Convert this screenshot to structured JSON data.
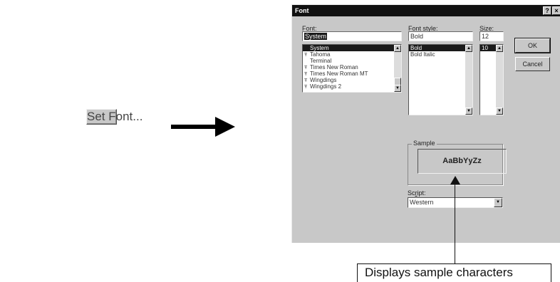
{
  "set_font_button": {
    "label": "Set Font..."
  },
  "dialog": {
    "title": "Font",
    "help_glyph": "?",
    "close_glyph": "×",
    "font": {
      "label_initial": "F",
      "label_rest": "ont:",
      "value": "System",
      "items": [
        {
          "name": "System",
          "truetype": false,
          "selected": true
        },
        {
          "name": "Tahoma",
          "truetype": true,
          "selected": false
        },
        {
          "name": "Terminal",
          "truetype": false,
          "selected": false
        },
        {
          "name": "Times New Roman",
          "truetype": true,
          "selected": false
        },
        {
          "name": "Times New Roman MT",
          "truetype": true,
          "selected": false
        },
        {
          "name": "Wingdings",
          "truetype": true,
          "selected": false
        },
        {
          "name": "Wingdings 2",
          "truetype": true,
          "selected": false
        }
      ]
    },
    "font_style": {
      "label_pre": "Font st",
      "label_initial": "y",
      "label_rest": "le:",
      "value": "Bold",
      "items": [
        {
          "name": "Bold",
          "selected": true
        },
        {
          "name": "Bold Italic",
          "selected": false
        }
      ]
    },
    "size": {
      "label_initial": "S",
      "label_rest": "ize:",
      "value": "12",
      "items": [
        {
          "name": "10",
          "selected": true
        }
      ]
    },
    "ok_label": "OK",
    "cancel_label": "Cancel",
    "sample": {
      "legend": "Sample",
      "text": "AaBbYyZz"
    },
    "script": {
      "label_pre": "Sc",
      "label_initial": "r",
      "label_rest": "ipt:",
      "value": "Western"
    },
    "truetype_glyph": "Ŧ",
    "scroll_up_glyph": "▲",
    "scroll_down_glyph": "▼"
  },
  "callout": {
    "text": "Displays sample characters"
  }
}
